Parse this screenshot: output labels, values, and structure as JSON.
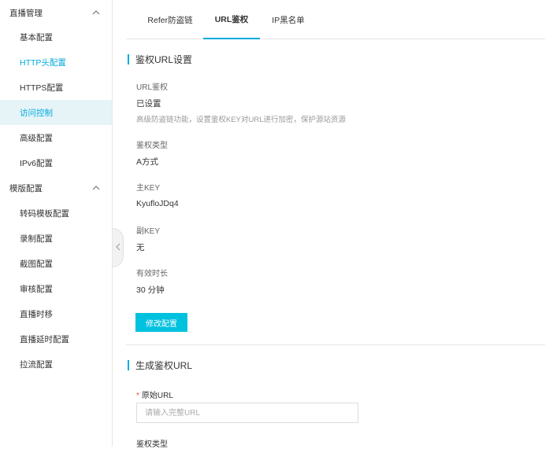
{
  "sidebar": {
    "groups": [
      {
        "title": "直播管理",
        "items": [
          {
            "label": "基本配置"
          },
          {
            "label": "HTTP头配置"
          },
          {
            "label": "HTTPS配置"
          },
          {
            "label": "访问控制"
          },
          {
            "label": "高级配置"
          },
          {
            "label": "IPv6配置"
          }
        ]
      },
      {
        "title": "模版配置",
        "items": [
          {
            "label": "转码模板配置"
          },
          {
            "label": "录制配置"
          },
          {
            "label": "截图配置"
          },
          {
            "label": "审核配置"
          },
          {
            "label": "直播时移"
          },
          {
            "label": "直播延时配置"
          },
          {
            "label": "拉流配置"
          }
        ]
      }
    ],
    "accent_color": "#00aadd",
    "selected_bg": "#e6f4f8"
  },
  "tabs": [
    {
      "label": "Refer防盗链"
    },
    {
      "label": "URL鉴权"
    },
    {
      "label": "IP黑名单"
    }
  ],
  "auth_settings": {
    "title": "鉴权URL设置",
    "url_auth_label": "URL鉴权",
    "url_auth_value": "已设置",
    "url_auth_desc": "高级防盗链功能，设置鉴权KEY对URL进行加密，保护源站资源",
    "auth_type_label": "鉴权类型",
    "auth_type_value": "A方式",
    "main_key_label": "主KEY",
    "main_key_value": "KyufloJDq4",
    "backup_key_label": "副KEY",
    "backup_key_value": "无",
    "valid_duration_label": "有效时长",
    "valid_duration_value": "30 分钟",
    "modify_button": "修改配置"
  },
  "generate": {
    "title": "生成鉴权URL",
    "original_url_label": "原始URL",
    "original_url_placeholder": "请输入完整URL",
    "auth_type_label": "鉴权类型"
  },
  "colors": {
    "button_bg": "#00c1de",
    "required": "#e74c3c"
  }
}
